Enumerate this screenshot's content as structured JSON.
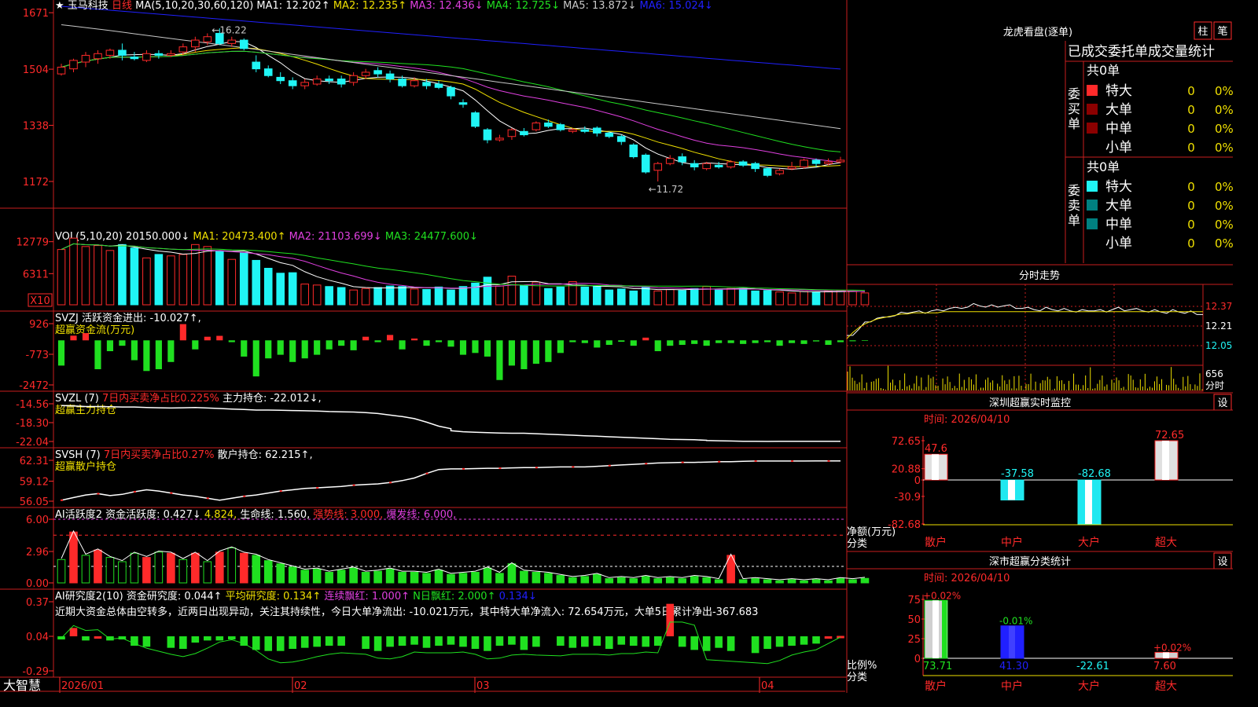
{
  "colors": {
    "bg": "#000000",
    "frame": "#c81e1e",
    "up": "#ff2a2a",
    "down": "#20f5f5",
    "white": "#ffffff",
    "yellow": "#f0e000",
    "magenta": "#e040e0",
    "green": "#20e020",
    "blue": "#2020ff",
    "gray": "#c8c8c8",
    "dkred": "#8b0000",
    "teal": "#008080"
  },
  "header": {
    "star": "★",
    "stock": "玉马科技",
    "period": "日线",
    "ma_label": "MA(5,10,20,30,60,120)",
    "ma1": "MA1: 12.202↑",
    "ma2": "MA2: 12.235↑",
    "ma3": "MA3: 12.436↓",
    "ma4": "MA4: 12.725↓",
    "ma5": "MA5: 13.872↓",
    "ma6": "MA6: 15.024↓"
  },
  "panels": {
    "vol": {
      "t0": "VOL(5,10,20)",
      "t1": "20150.000↓",
      "t2": "MA1: 20473.400↑",
      "t3": "MA2: 21103.699↓",
      "t4": "MA3: 24477.600↓",
      "unit": "X10"
    },
    "svzj": {
      "t0": "SVZJ",
      "t1": "活跃资金进出: -10.027↑,",
      "t2": "超赢资金流(万元)"
    },
    "svzl": {
      "t0": "SVZL (7)",
      "t1": "7日内买卖净占比0.225%",
      "t2": "主力持仓: -22.012↓,",
      "t3": "超赢主力持仓"
    },
    "svsh": {
      "t0": "SVSH (7)",
      "t1": "7日内买卖净占比0.27%",
      "t2": "散户持仓: 62.215↑,",
      "t3": "超赢散户持仓"
    },
    "ai1": {
      "t0": "AI活跃度2",
      "t1": "资金活跃度: 0.427↓",
      "t2": "4.824,",
      "t3": "生命线: 1.560,",
      "t4": "强势线: 3.000,",
      "t5": "爆发线: 6.000,"
    },
    "ai2": {
      "t0": "AI研究度2(10)",
      "t1": "资金研究度: 0.044↑",
      "t2": "平均研究度: 0.134↑",
      "t3": "连续飘红: 1.000↑",
      "t4": "N日飘红: 2.000↑",
      "t5": "0.134↓",
      "note": "近期大资金总体由空转多，近两日出现异动，关注其持续性，今日大单净流出: -10.021万元，其中特大单净流入: 72.654万元，大单5日累计净出-367.683"
    }
  },
  "bottom": {
    "brand": "大智慧",
    "months": [
      "2026/01",
      "02",
      "03",
      "04"
    ]
  },
  "right": {
    "lhkp": {
      "title": "龙虎看盘(逐单)",
      "btn1": "柱",
      "btn2": "笔",
      "sub": "已成交委托单成交量统计",
      "buy_total": "共0单",
      "sell_total": "共0单",
      "buy_side": "委买单",
      "sell_side": "委卖单",
      "buy_rows": [
        [
          "特大",
          "0",
          "0%"
        ],
        [
          "大单",
          "0",
          "0%"
        ],
        [
          "中单",
          "0",
          "0%"
        ],
        [
          "小单",
          "0",
          "0%"
        ]
      ],
      "sell_rows": [
        [
          "特大",
          "0",
          "0%"
        ],
        [
          "大单",
          "0",
          "0%"
        ],
        [
          "中单",
          "0",
          "0%"
        ],
        [
          "小单",
          "0",
          "0%"
        ]
      ]
    },
    "fs": {
      "title": "分时走势",
      "p1": "12.37",
      "p2": "12.21",
      "p3": "12.05",
      "v1": "656",
      "v2": "分时"
    },
    "szcy": {
      "title": "深圳超赢实时监控",
      "btn": "设",
      "time": "时间: 2026/04/10",
      "ylabel": "净额(万元)",
      "xlabel": "分类",
      "ticks": [
        "72.65",
        "20.88",
        "0",
        "-30.9",
        "-82.68"
      ],
      "cats": [
        "散户",
        "中户",
        "大户",
        "超大"
      ],
      "vals": [
        47.6,
        -37.58,
        -82.68,
        72.65
      ],
      "labels": [
        "47.6",
        "-37.58",
        "-82.68",
        "72.65"
      ]
    },
    "scfl": {
      "title": "深市超赢分类统计",
      "btn": "设",
      "time": "时间: 2026/04/10",
      "ylabel": "比例%",
      "xlabel": "分类",
      "ticks": [
        "75",
        "50",
        "25",
        "0"
      ],
      "cats": [
        "散户",
        "中户",
        "大户",
        "超大"
      ],
      "vals": [
        73.71,
        41.3,
        -22.61,
        7.6
      ],
      "vlabels": [
        "73.71",
        "41.30",
        "-22.61",
        "7.60"
      ],
      "plabels": [
        "+0.02%",
        "-0.01%",
        "",
        "+0.02%"
      ]
    }
  },
  "chart_data": {
    "type": "candlestick",
    "x": "daily bars, 2026/01 – 2026/04",
    "ylim": [
      1100,
      1690
    ],
    "y_ticks": [
      "1671",
      "1504",
      "1338",
      "1172"
    ],
    "annotations": [
      "16.22",
      "11.72"
    ],
    "candles": [
      [
        14.9,
        15.1,
        14.85,
        15.2
      ],
      [
        15.05,
        15.3,
        14.95,
        15.35
      ],
      [
        15.25,
        15.45,
        15.1,
        15.55
      ],
      [
        15.35,
        15.5,
        15.2,
        15.6
      ],
      [
        15.45,
        15.6,
        15.35,
        15.65
      ],
      [
        15.6,
        15.45,
        15.3,
        15.8
      ],
      [
        15.4,
        15.35,
        15.3,
        15.55
      ],
      [
        15.3,
        15.5,
        15.25,
        15.6
      ],
      [
        15.5,
        15.45,
        15.35,
        15.6
      ],
      [
        15.45,
        15.5,
        15.4,
        15.6
      ],
      [
        15.55,
        15.7,
        15.45,
        15.8
      ],
      [
        15.7,
        15.9,
        15.55,
        16.0
      ],
      [
        15.85,
        16.0,
        15.75,
        16.1
      ],
      [
        16.1,
        15.8,
        15.75,
        16.25
      ],
      [
        15.8,
        15.9,
        15.7,
        16.0
      ],
      [
        15.9,
        15.65,
        15.6,
        15.95
      ],
      [
        15.25,
        15.05,
        14.95,
        15.45
      ],
      [
        15.05,
        14.85,
        14.8,
        15.15
      ],
      [
        14.8,
        14.7,
        14.6,
        14.95
      ],
      [
        14.7,
        14.55,
        14.45,
        14.8
      ],
      [
        14.55,
        14.65,
        14.45,
        14.75
      ],
      [
        14.6,
        14.75,
        14.55,
        14.85
      ],
      [
        14.75,
        14.7,
        14.6,
        14.85
      ],
      [
        14.75,
        14.6,
        14.5,
        14.85
      ],
      [
        14.65,
        14.85,
        14.55,
        14.95
      ],
      [
        14.85,
        14.95,
        14.75,
        15.05
      ],
      [
        15.0,
        14.9,
        14.8,
        15.1
      ],
      [
        14.9,
        14.75,
        14.65,
        15.0
      ],
      [
        14.75,
        14.55,
        14.5,
        14.85
      ],
      [
        14.55,
        14.7,
        14.5,
        14.8
      ],
      [
        14.65,
        14.55,
        14.45,
        14.75
      ],
      [
        14.6,
        14.5,
        14.45,
        14.7
      ],
      [
        14.5,
        14.25,
        14.15,
        14.55
      ],
      [
        14.05,
        14.0,
        13.9,
        14.15
      ],
      [
        13.75,
        13.35,
        13.3,
        13.8
      ],
      [
        13.25,
        12.95,
        12.85,
        13.3
      ],
      [
        12.95,
        13.0,
        12.9,
        13.1
      ],
      [
        13.05,
        13.25,
        12.95,
        13.3
      ],
      [
        13.2,
        13.1,
        13.05,
        13.3
      ],
      [
        13.25,
        13.45,
        13.2,
        13.5
      ],
      [
        13.45,
        13.35,
        13.3,
        13.55
      ],
      [
        13.4,
        13.25,
        13.2,
        13.45
      ],
      [
        13.2,
        13.25,
        13.15,
        13.3
      ],
      [
        13.25,
        13.2,
        13.15,
        13.35
      ],
      [
        13.3,
        13.15,
        13.05,
        13.35
      ],
      [
        13.15,
        13.05,
        13.0,
        13.2
      ],
      [
        13.05,
        12.9,
        12.8,
        13.1
      ],
      [
        12.8,
        12.45,
        12.4,
        12.85
      ],
      [
        12.5,
        12.0,
        11.95,
        12.55
      ],
      [
        12.05,
        12.25,
        11.72,
        12.3
      ],
      [
        12.25,
        12.4,
        12.2,
        12.5
      ],
      [
        12.45,
        12.3,
        12.2,
        12.55
      ],
      [
        12.25,
        12.15,
        12.05,
        12.35
      ],
      [
        12.1,
        12.25,
        12.05,
        12.3
      ],
      [
        12.2,
        12.15,
        12.1,
        12.3
      ],
      [
        12.15,
        12.3,
        12.1,
        12.35
      ],
      [
        12.3,
        12.2,
        12.15,
        12.35
      ],
      [
        12.25,
        12.1,
        12.0,
        12.3
      ],
      [
        12.1,
        11.9,
        11.85,
        12.15
      ],
      [
        11.95,
        12.05,
        11.9,
        12.1
      ],
      [
        12.1,
        12.15,
        12.05,
        12.3
      ],
      [
        12.15,
        12.35,
        12.1,
        12.4
      ],
      [
        12.35,
        12.25,
        12.15,
        12.4
      ],
      [
        12.25,
        12.3,
        12.2,
        12.4
      ],
      [
        12.3,
        12.35,
        12.25,
        12.45
      ]
    ],
    "volume": {
      "y_ticks": [
        "12779",
        "6311"
      ],
      "values": [
        11.2,
        13.5,
        11.8,
        12.0,
        11.0,
        12.2,
        11.5,
        9.5,
        10.2,
        9.9,
        10.2,
        12.2,
        11.8,
        10.8,
        9.2,
        10.6,
        9.0,
        7.4,
        6.4,
        6.5,
        4.2,
        4.0,
        3.7,
        3.5,
        3.0,
        3.3,
        3.5,
        3.8,
        3.7,
        3.2,
        3.1,
        3.6,
        3.0,
        3.7,
        4.4,
        5.6,
        3.8,
        5.8,
        3.9,
        4.6,
        3.3,
        3.6,
        4.7,
        3.6,
        3.7,
        3.0,
        3.2,
        2.8,
        3.6,
        2.8,
        3.1,
        2.9,
        3.3,
        3.7,
        3.0,
        3.3,
        3.3,
        2.8,
        2.9,
        2.6,
        2.4,
        2.7,
        2.6,
        2.8,
        2.9,
        2.7,
        2.4
      ]
    },
    "svzj": {
      "y_ticks": [
        "926",
        "-773",
        "-2472"
      ],
      "values": [
        -1400,
        260,
        400,
        -1600,
        -600,
        -300,
        -1100,
        -1700,
        -1600,
        -1200,
        900,
        -500,
        200,
        250,
        -100,
        -900,
        -2000,
        -1000,
        -800,
        -1200,
        -1000,
        -800,
        -500,
        -300,
        -550,
        200,
        -100,
        300,
        -500,
        100,
        -300,
        -100,
        -350,
        -800,
        -700,
        -900,
        -2200,
        -1400,
        -1600,
        -1300,
        -1200,
        -700,
        -100,
        -150,
        -400,
        -250,
        -80,
        -300,
        150,
        -600,
        -300,
        -250,
        -200,
        -300,
        -150,
        -150,
        -200,
        -150,
        -100,
        -300,
        -150,
        -200,
        -60,
        -250,
        -100,
        -50,
        -30
      ]
    },
    "svzl": {
      "y_ticks": [
        "-14.56",
        "-18.30",
        "-22.04"
      ],
      "values": [
        -14.9,
        -15.0,
        -15.1,
        -15.1,
        -15.15,
        -15.2,
        -15.2,
        -15.3,
        -15.35,
        -15.4,
        -15.35,
        -15.3,
        -15.3,
        -15.4,
        -15.5,
        -15.6,
        -15.7,
        -15.8,
        -15.8,
        -15.85,
        -15.9,
        -15.95,
        -16.0,
        -16.1,
        -16.15,
        -16.2,
        -16.3,
        -16.5,
        -16.8,
        -17.1,
        -17.5,
        -18.2,
        -19.0,
        -19.5,
        -19.9,
        -20.1,
        -20.2,
        -20.3,
        -20.35,
        -20.4,
        -20.4,
        -20.5,
        -20.6,
        -20.7,
        -20.8,
        -20.9,
        -21.0,
        -21.1,
        -21.2,
        -21.3,
        -21.4,
        -21.5,
        -21.6,
        -21.65,
        -21.7,
        -21.8,
        -21.85,
        -21.9,
        -21.95,
        -22.0,
        -22.0,
        -22.02,
        -22.0,
        -22.01,
        -22.01,
        -22.01,
        -22.01,
        -22.012
      ]
    },
    "svsh": {
      "y_ticks": [
        "62.31",
        "59.12",
        "56.05"
      ],
      "values": [
        56.2,
        56.6,
        57.0,
        57.2,
        56.9,
        57.1,
        57.5,
        57.8,
        57.6,
        57.3,
        57.0,
        56.8,
        56.5,
        56.2,
        56.5,
        56.8,
        57.0,
        57.3,
        57.6,
        57.8,
        58.0,
        58.1,
        58.2,
        58.3,
        58.5,
        58.6,
        58.7,
        58.9,
        59.2,
        59.6,
        60.3,
        60.9,
        61.0,
        61.0,
        61.05,
        61.1,
        61.1,
        61.15,
        61.2,
        61.2,
        61.25,
        61.3,
        61.3,
        61.3,
        61.4,
        61.5,
        61.6,
        61.7,
        61.8,
        61.9,
        61.95,
        62.0,
        62.0,
        62.05,
        62.1,
        62.1,
        62.15,
        62.2,
        62.2,
        62.2,
        62.2,
        62.2,
        62.21,
        62.21,
        62.215
      ]
    },
    "ai1": {
      "y_ticks": [
        "6.00",
        "2.96",
        "0.00"
      ],
      "lines": {
        "strong": 3.0,
        "burst": 6.0,
        "life": 1.56
      },
      "values": [
        2.2,
        4.8,
        2.6,
        3.1,
        2.4,
        2.0,
        2.8,
        2.4,
        2.9,
        2.8,
        2.2,
        2.8,
        2.0,
        2.9,
        3.3,
        2.8,
        2.6,
        2.1,
        1.8,
        1.5,
        1.2,
        1.3,
        1.0,
        1.2,
        1.4,
        1.0,
        1.1,
        1.3,
        1.0,
        1.0,
        0.9,
        1.2,
        0.8,
        0.9,
        1.0,
        1.4,
        0.9,
        1.8,
        1.1,
        1.0,
        0.9,
        0.7,
        0.5,
        0.6,
        0.8,
        0.4,
        0.5,
        0.4,
        0.6,
        0.4,
        0.5,
        0.4,
        0.6,
        0.5,
        0.3,
        2.6,
        0.3,
        0.4,
        0.3,
        0.2,
        0.3,
        0.2,
        0.3,
        0.2,
        0.4,
        0.3,
        0.427
      ]
    },
    "ai2": {
      "y_ticks": [
        "0.37",
        "0.04",
        "-0.29"
      ],
      "values": [
        0.01,
        0.12,
        0.0,
        0.02,
        0.0,
        0.01,
        -0.05,
        -0.06,
        -0.07,
        -0.08,
        -0.02,
        0.0,
        0.0,
        0.01,
        -0.05,
        -0.09,
        -0.1,
        -0.1,
        -0.08,
        -0.07,
        -0.06,
        -0.05,
        -0.05,
        -0.08,
        -0.1,
        -0.06,
        -0.05,
        -0.04,
        -0.07,
        -0.05,
        -0.04,
        -0.06,
        -0.08,
        -0.1,
        -0.05,
        -0.04,
        -0.09,
        -0.06,
        -0.05,
        -0.07,
        -0.06,
        -0.05,
        -0.08,
        -0.04,
        -0.05,
        -0.06,
        -0.05,
        0.35,
        -0.06,
        -0.09,
        -0.1,
        -0.07,
        -0.1,
        -0.12,
        -0.08,
        -0.06,
        -0.05,
        -0.04,
        -0.03,
        0.03,
        0.044
      ]
    },
    "intraday": {
      "price": [
        12.12,
        12.14,
        12.19,
        12.23,
        12.25,
        12.28,
        12.27,
        12.29,
        12.3,
        12.31,
        12.32,
        12.33,
        12.32,
        12.32,
        12.34,
        12.33,
        12.34,
        12.36,
        12.35,
        12.36,
        12.37,
        12.38,
        12.38,
        12.37,
        12.37,
        12.37,
        12.38,
        12.37,
        12.36,
        12.36,
        12.35,
        12.35,
        12.34,
        12.35,
        12.35,
        12.34,
        12.34,
        12.34,
        12.33,
        12.33,
        12.34,
        12.34,
        12.33,
        12.33,
        12.35,
        12.35,
        12.34,
        12.35,
        12.34,
        12.34,
        12.33,
        12.33,
        12.33,
        12.32,
        12.33,
        12.33,
        12.32,
        12.32,
        12.31,
        12.31
      ],
      "avg": [
        12.12,
        12.17,
        12.21,
        12.24,
        12.26,
        12.28,
        12.29,
        12.3,
        12.31,
        12.32,
        12.32,
        12.33,
        12.33,
        12.33,
        12.33,
        12.33,
        12.34,
        12.34,
        12.34,
        12.34,
        12.34,
        12.34,
        12.34,
        12.34,
        12.34,
        12.34,
        12.34,
        12.34,
        12.34,
        12.34,
        12.34,
        12.34,
        12.34,
        12.34,
        12.34,
        12.34,
        12.34,
        12.34,
        12.34,
        12.34,
        12.34,
        12.34,
        12.34,
        12.34,
        12.34,
        12.34,
        12.34,
        12.34,
        12.34,
        12.34,
        12.34,
        12.34,
        12.34,
        12.34,
        12.34,
        12.34,
        12.34,
        12.34,
        12.34,
        12.34
      ]
    }
  }
}
